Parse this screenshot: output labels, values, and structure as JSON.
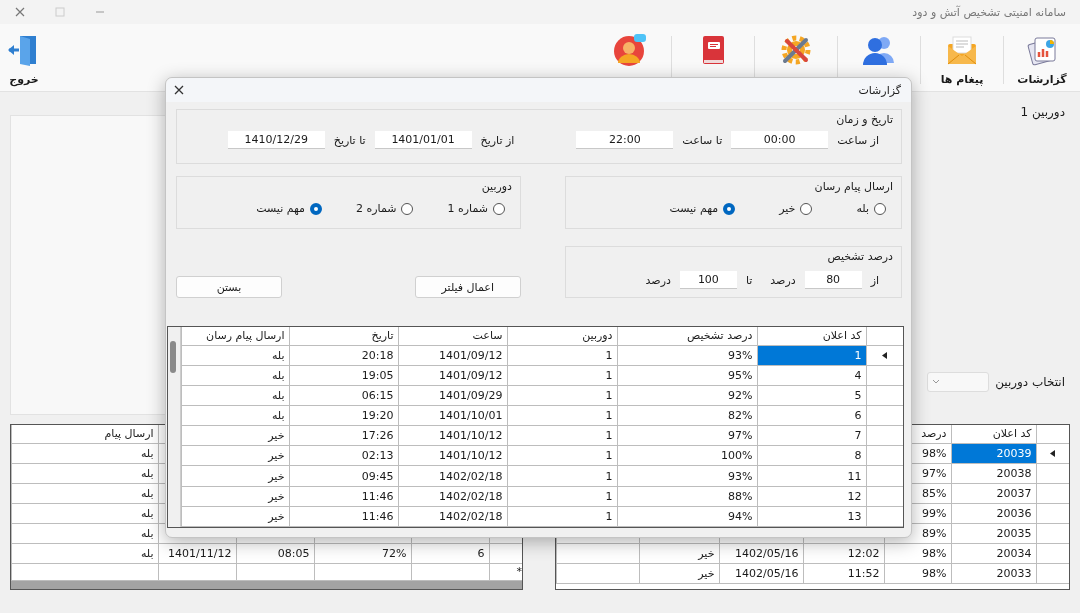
{
  "window": {
    "title": "سامانه امنیتی تشخیص آتش و دود"
  },
  "toolbar": {
    "items": [
      {
        "label": "گزارشات"
      },
      {
        "label": "پیغام ها"
      }
    ],
    "exit": {
      "label": "خروج"
    }
  },
  "main": {
    "camera_title": "دوربین 1",
    "camera_select_label": "انتخاب دوربین"
  },
  "alerts_table": {
    "columns": [
      "کد اعلان",
      "درصد"
    ],
    "rows": [
      {
        "selected": true,
        "cells": [
          "20039",
          "98%"
        ]
      },
      {
        "selected": false,
        "cells": [
          "20038",
          "97%"
        ]
      },
      {
        "selected": false,
        "cells": [
          "20037",
          "85%"
        ]
      },
      {
        "selected": false,
        "cells": [
          "20036",
          "99%"
        ]
      },
      {
        "selected": false,
        "cells": [
          "20035",
          "89%"
        ]
      },
      {
        "selected": false,
        "cells": [
          "20034",
          "98%",
          "12:02",
          "1402/05/16",
          "خیر"
        ]
      },
      {
        "selected": false,
        "cells": [
          "20033",
          "98%",
          "11:52",
          "1402/05/16",
          "خیر"
        ]
      }
    ]
  },
  "messages_table": {
    "columns": [
      "ارسال پیام"
    ],
    "rows": [
      {
        "message": "بله"
      },
      {
        "message": "بله"
      },
      {
        "message": "بله"
      },
      {
        "message": "بله"
      },
      {
        "message": "بله"
      },
      {
        "column_1": "6",
        "column_2": "72%",
        "column_3": "08:05",
        "column_4": "1401/11/12",
        "message": "بله"
      }
    ],
    "new_row_marker": "*"
  },
  "dialog": {
    "title": "گزارشات",
    "date_time": {
      "title": "تاریخ و زمان",
      "parts": [
        {
          "kind": "text",
          "text": "از ساعت"
        },
        {
          "kind": "field",
          "value": "00:00"
        },
        {
          "kind": "text",
          "text": "تا ساعت"
        },
        {
          "kind": "field",
          "value": "22:00"
        },
        {
          "kind": "text",
          "text": "از تاریخ"
        },
        {
          "kind": "field",
          "value": "1401/01/01"
        },
        {
          "kind": "text",
          "text": "تا تاریخ"
        },
        {
          "kind": "field",
          "value": "1410/12/29"
        }
      ]
    },
    "message_sender": {
      "title": "ارسال پیام رسان",
      "options": [
        {
          "label": "بله",
          "selected": false
        },
        {
          "label": "خیر",
          "selected": false
        },
        {
          "label": "مهم نیست",
          "selected": true
        }
      ]
    },
    "camera": {
      "title": "دوربین",
      "options": [
        {
          "label": "شماره 1",
          "selected": false
        },
        {
          "label": "شماره 2",
          "selected": false
        },
        {
          "label": "مهم نیست",
          "selected": true
        }
      ]
    },
    "detection_percent": {
      "title": "درصد تشخیص",
      "parts": [
        {
          "kind": "text",
          "text": "از"
        },
        {
          "kind": "field",
          "value": "80"
        },
        {
          "kind": "text",
          "text": "درصد"
        },
        {
          "kind": "text",
          "text": "تا"
        },
        {
          "kind": "field",
          "value": "100"
        },
        {
          "kind": "text",
          "text": "درصد"
        }
      ]
    },
    "buttons": [
      {
        "kind": "apply",
        "label": "اعمال فیلتر"
      },
      {
        "kind": "close",
        "label": "بستن"
      }
    ],
    "table": {
      "columns": [
        "کد اعلان",
        "درصد تشخیص",
        "دوربین",
        "ساعت",
        "تاریخ",
        "ارسال پیام رسان"
      ],
      "rows": [
        {
          "selected": true,
          "cells": [
            "1",
            "93%",
            "1",
            "1401/09/12",
            "20:18",
            "بله"
          ]
        },
        {
          "selected": false,
          "cells": [
            "4",
            "95%",
            "1",
            "1401/09/12",
            "19:05",
            "بله"
          ]
        },
        {
          "selected": false,
          "cells": [
            "5",
            "92%",
            "1",
            "1401/09/29",
            "06:15",
            "بله"
          ]
        },
        {
          "selected": false,
          "cells": [
            "6",
            "82%",
            "1",
            "1401/10/01",
            "19:20",
            "بله"
          ]
        },
        {
          "selected": false,
          "cells": [
            "7",
            "97%",
            "1",
            "1401/10/12",
            "17:26",
            "خیر"
          ]
        },
        {
          "selected": false,
          "cells": [
            "8",
            "100%",
            "1",
            "1401/10/12",
            "02:13",
            "خیر"
          ]
        },
        {
          "selected": false,
          "cells": [
            "11",
            "93%",
            "1",
            "1402/02/18",
            "09:45",
            "خیر"
          ]
        },
        {
          "selected": false,
          "cells": [
            "12",
            "88%",
            "1",
            "1402/02/18",
            "11:46",
            "خیر"
          ]
        },
        {
          "selected": false,
          "cells": [
            "13",
            "94%",
            "1",
            "1402/02/18",
            "11:46",
            "خیر"
          ]
        }
      ]
    }
  }
}
